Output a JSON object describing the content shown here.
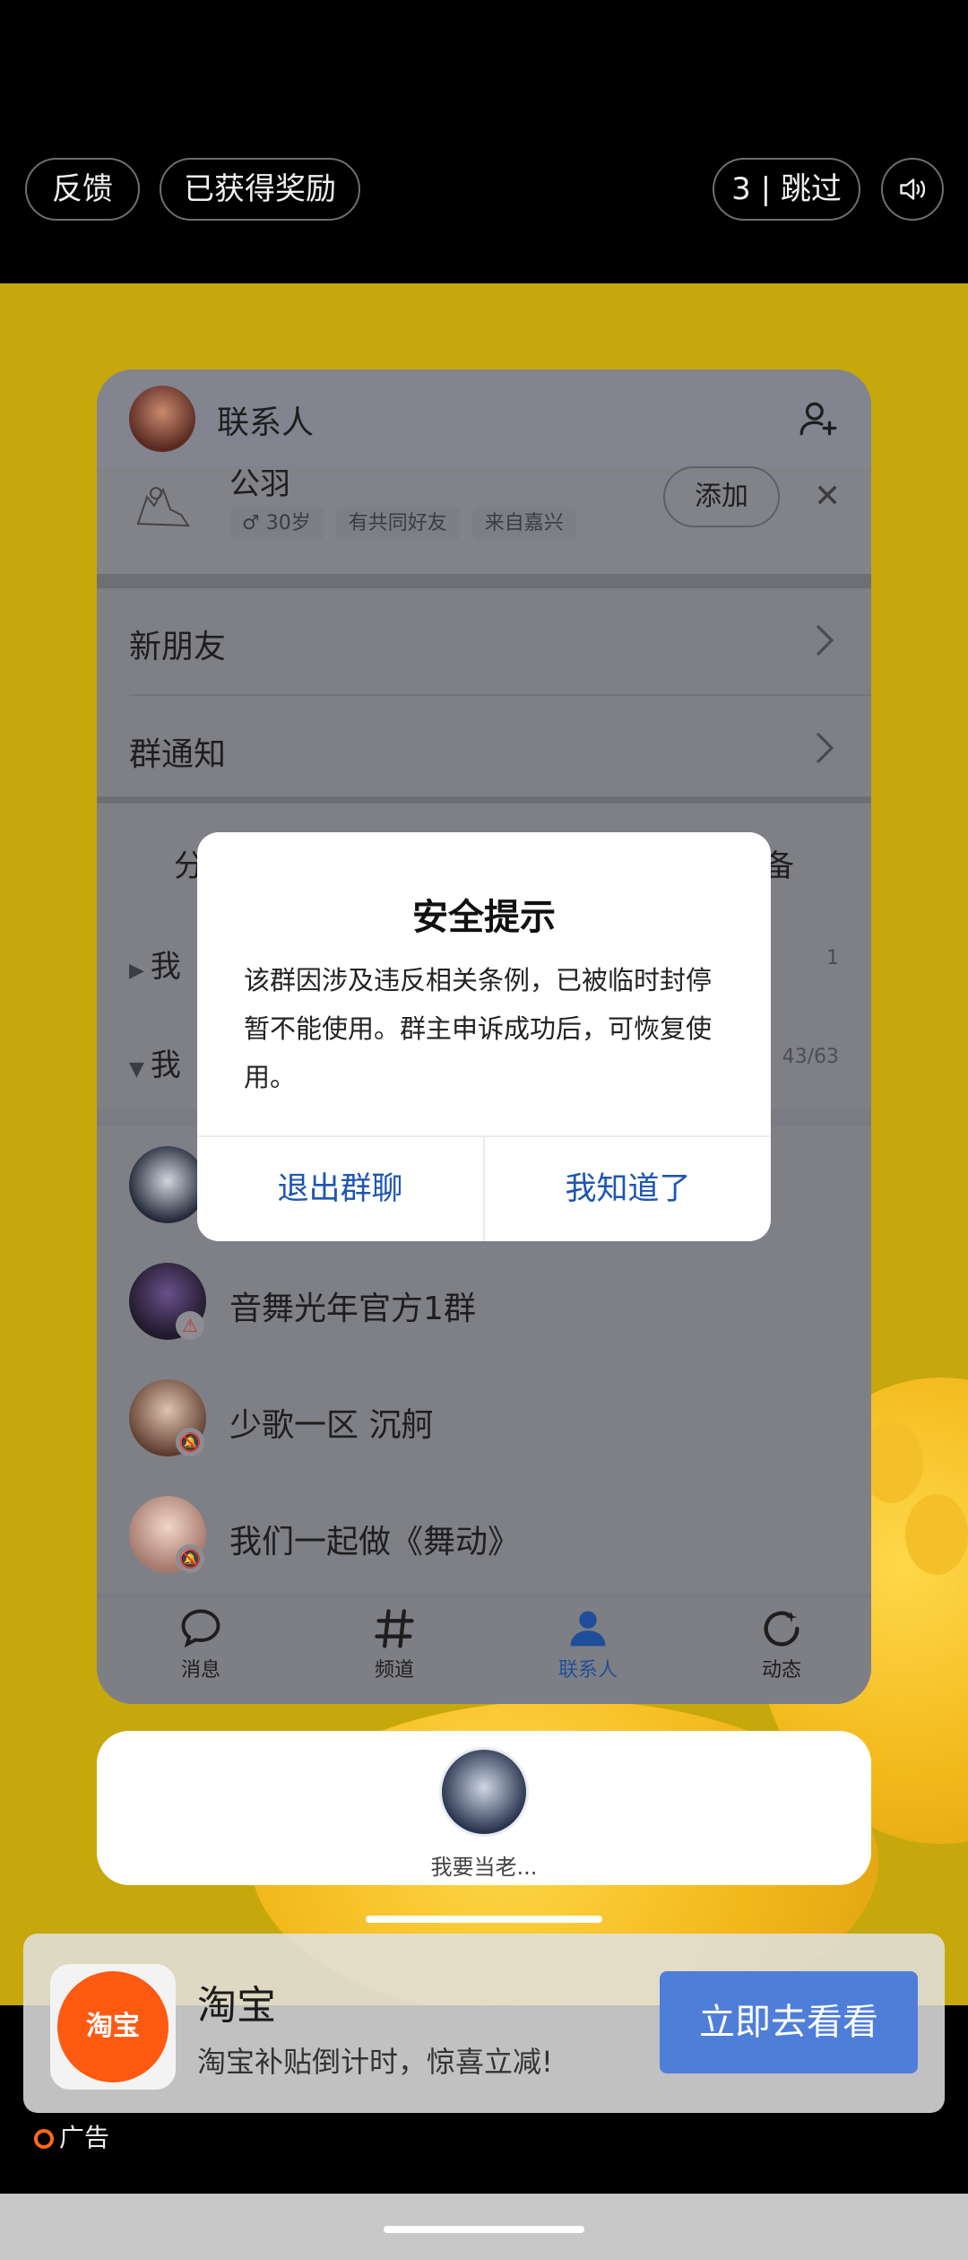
{
  "ad_top": {
    "feedback_label": "反馈",
    "reward_label": "已获得奖励",
    "skip_label": "3 | 跳过",
    "sound_icon": "speaker-icon"
  },
  "app": {
    "header_title": "联系人",
    "suggestion": {
      "name": "公羽",
      "tags": [
        "♂ 30岁",
        "有共同好友",
        "来自嘉兴"
      ],
      "add_label": "添加",
      "close_glyph": "✕"
    },
    "rows": [
      {
        "label": "新朋友"
      },
      {
        "label": "群通知"
      }
    ],
    "tabs_row": {
      "left_partial": "分",
      "right_partial": "备"
    },
    "groups": [
      {
        "label": "我",
        "count": "1"
      },
      {
        "label": "我",
        "count": "43/63"
      }
    ],
    "contacts": [
      {
        "name": "音舞光年官方1群",
        "badge": "⚠"
      },
      {
        "name": "少歌一区 沉舸",
        "badge": "🔕"
      },
      {
        "name": "我们一起做《舞动》",
        "badge": "🔕"
      }
    ],
    "bottom_tabs": [
      {
        "label": "消息",
        "icon": "chat-bubble-icon"
      },
      {
        "label": "频道",
        "icon": "hash-icon"
      },
      {
        "label": "联系人",
        "icon": "person-icon",
        "active": true
      },
      {
        "label": "动态",
        "icon": "refresh-star-icon"
      }
    ]
  },
  "dialog": {
    "title": "安全提示",
    "body": "该群因涉及违反相关条例，已被临时封停暂不能使用。群主申诉成功后，可恢复使用。",
    "exit_label": "退出群聊",
    "ok_label": "我知道了"
  },
  "bubble": {
    "label": "我要当老..."
  },
  "ad_card": {
    "logo_text": "淘宝",
    "name": "淘宝",
    "desc": "淘宝补贴倒计时，惊喜立减!",
    "cta_label": "立即去看看",
    "ad_tag": "广告"
  },
  "colors": {
    "yellow_bg": "#c6a80c",
    "accent_blue": "#1e56b0",
    "cta_blue": "#4f7ed9",
    "taobao_orange": "#ff5a12"
  }
}
